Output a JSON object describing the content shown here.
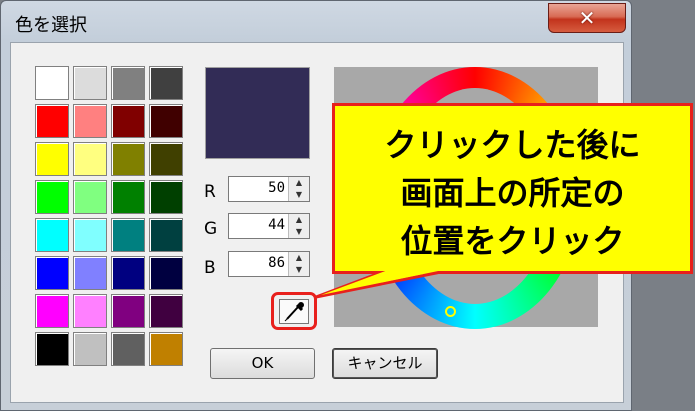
{
  "window": {
    "title": "色を選択",
    "close_glyph": "✕"
  },
  "swatches": [
    "#ffffff",
    "#dcdcdc",
    "#808080",
    "#404040",
    "#ff0000",
    "#ff8080",
    "#800000",
    "#400000",
    "#ffff00",
    "#ffff80",
    "#808000",
    "#404000",
    "#00ff00",
    "#80ff80",
    "#008000",
    "#004000",
    "#00ffff",
    "#80ffff",
    "#008080",
    "#004040",
    "#0000ff",
    "#8080ff",
    "#000080",
    "#000040",
    "#ff00ff",
    "#ff80ff",
    "#800080",
    "#400040",
    "#000000",
    "#c0c0c0",
    "#606060",
    "#c08000"
  ],
  "current_color": "#322c56",
  "rgb": {
    "r_label": "R",
    "r_value": "50",
    "g_label": "G",
    "g_value": "44",
    "b_label": "B",
    "b_value": "86"
  },
  "buttons": {
    "ok": "OK",
    "cancel": "キャンセル"
  },
  "callout": {
    "line1": "クリックした後に",
    "line2": "画面上の所定の",
    "line3": "位置をクリック"
  },
  "icons": {
    "eyedropper": "eyedropper-icon",
    "spin_up": "▲",
    "spin_down": "▼"
  }
}
